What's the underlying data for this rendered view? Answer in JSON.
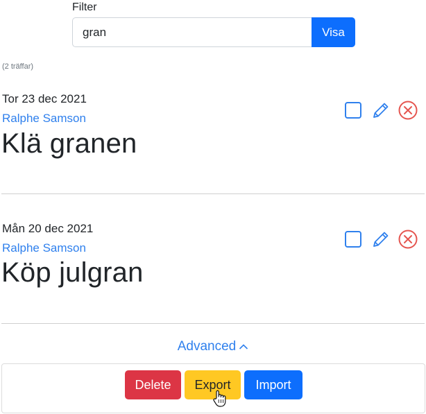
{
  "filter": {
    "label": "Filter",
    "value": "gran",
    "button_label": "Visa"
  },
  "hits_text": "(2 träffar)",
  "items": [
    {
      "date": "Tor 23 dec 2021",
      "author": "Ralphe Samson",
      "title": "Klä granen"
    },
    {
      "date": "Mån 20 dec 2021",
      "author": "Ralphe Samson",
      "title": "Köp julgran"
    }
  ],
  "advanced": {
    "label": "Advanced",
    "delete_label": "Delete",
    "export_label": "Export",
    "import_label": "Import"
  },
  "colors": {
    "primary": "#0d6efd",
    "link": "#2f80ed",
    "danger": "#dc3545",
    "warning": "#ffc823",
    "delete_icon": "#e5554f"
  }
}
